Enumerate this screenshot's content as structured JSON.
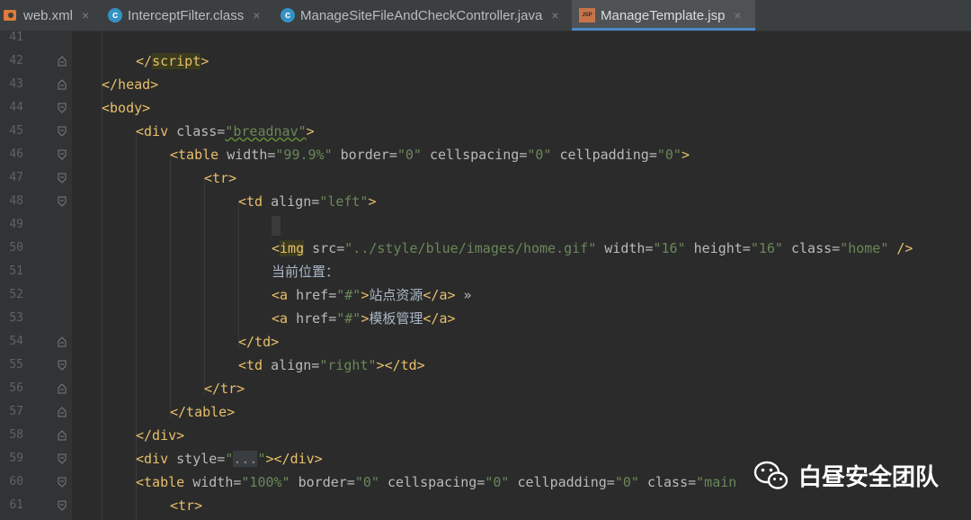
{
  "tabs": [
    {
      "label": "web.xml",
      "icon": "xml-file-icon",
      "active": false
    },
    {
      "label": "InterceptFilter.class",
      "icon": "class-file-icon",
      "active": false
    },
    {
      "label": "ManageSiteFileAndCheckController.java",
      "icon": "class-file-icon",
      "active": false
    },
    {
      "label": "ManageTemplate.jsp",
      "icon": "jsp-file-icon",
      "active": true
    }
  ],
  "close_glyph": "×",
  "line_numbers": [
    "41",
    "42",
    "43",
    "44",
    "45",
    "46",
    "47",
    "48",
    "49",
    "50",
    "51",
    "52",
    "53",
    "54",
    "55",
    "56",
    "57",
    "58",
    "59",
    "60",
    "61"
  ],
  "code": {
    "l42": {
      "open": "</",
      "tag": "script",
      "close": ">"
    },
    "l43": "</head>",
    "l44": "<body>",
    "l45": {
      "pre": "<div ",
      "attr": "class=",
      "val": "\"breadnav\"",
      "post": ">"
    },
    "l46": {
      "pre": "<table ",
      "a1": "width=",
      "v1": "\"99.9%\"",
      "a2": " border=",
      "v2": "\"0\"",
      "a3": " cellspacing=",
      "v3": "\"0\"",
      "a4": " cellpadding=",
      "v4": "\"0\"",
      "post": ">"
    },
    "l47": "<tr>",
    "l48": {
      "pre": "<td ",
      "attr": "align=",
      "val": "\"left\"",
      "post": ">"
    },
    "l50": {
      "open": "<",
      "tag": "img",
      "a1": " src=",
      "v1": "\"../style/blue/images/home.gif\"",
      "a2": " width=",
      "v2": "\"16\"",
      "a3": " height=",
      "v3": "\"16\"",
      "a4": " class=",
      "v4": "\"home\"",
      "post": " />"
    },
    "l51": "当前位置：",
    "l52": {
      "pre": "<a ",
      "attr": "href=",
      "val": "\"#\"",
      "gt": ">",
      "text": "站点资源",
      "end": "</a>",
      "raquo": " »"
    },
    "l53": {
      "pre": "<a ",
      "attr": "href=",
      "val": "\"#\"",
      "gt": ">",
      "text": "模板管理",
      "end": "</a>"
    },
    "l54": "</td>",
    "l55": {
      "pre": "<td ",
      "attr": "align=",
      "val": "\"right\"",
      "post": "></td>"
    },
    "l56": "</tr>",
    "l57": "</table>",
    "l58": "</div>",
    "l59": {
      "pre": "<div ",
      "attr": "style=",
      "q1": "\"",
      "dots": "...",
      "q2": "\"",
      "post": "></div>"
    },
    "l60": {
      "pre": "<table ",
      "a1": "width=",
      "v1": "\"100%\"",
      "a2": " border=",
      "v2": "\"0\"",
      "a3": " cellspacing=",
      "v3": "\"0\"",
      "a4": " cellpadding=",
      "v4": "\"0\"",
      "a5": " class=",
      "v5": "\"main"
    },
    "l61": "<tr>"
  },
  "watermark": {
    "text": "白昼安全团队",
    "icon": "wechat-icon"
  },
  "colors": {
    "tag": "#e8bf6a",
    "attribute": "#bababa",
    "value": "#6a8759",
    "text": "#a9b7c6",
    "background": "#2b2b2b",
    "accent": "#4a88c7"
  }
}
